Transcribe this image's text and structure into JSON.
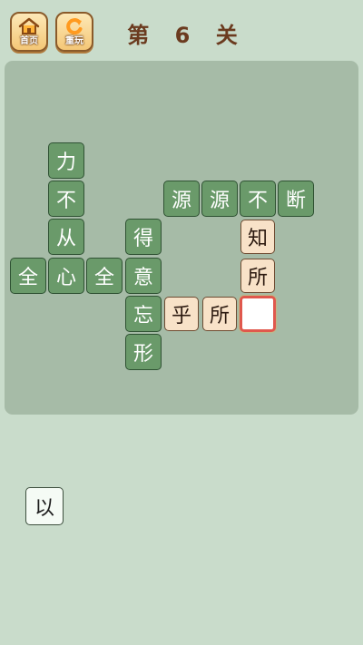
{
  "header": {
    "home_label": "首页",
    "replay_label": "重玩",
    "level_title": "第 6 关"
  },
  "board": {
    "fixed_chars": {
      "li": "力",
      "bu_1": "不",
      "cong": "从",
      "quan_1": "全",
      "xin": "心",
      "quan_2": "全",
      "de": "得",
      "yi": "意",
      "wang": "忘",
      "xing": "形",
      "yuan_1": "源",
      "yuan_2": "源",
      "bu_2": "不",
      "duan": "断"
    },
    "answer_chars": {
      "zhi": "知",
      "suo_1": "所",
      "hu": "乎",
      "suo_2": "所"
    },
    "blank_cell": ""
  },
  "candidate_pool": {
    "chars": [
      "以"
    ]
  },
  "colors": {
    "background": "#c9dccb",
    "board": "#a6bba7",
    "fixed_tile": "#6a9a6a",
    "answer_tile": "#f8e2c8",
    "selected_border": "#e0584d",
    "title": "#6b3b1f"
  }
}
